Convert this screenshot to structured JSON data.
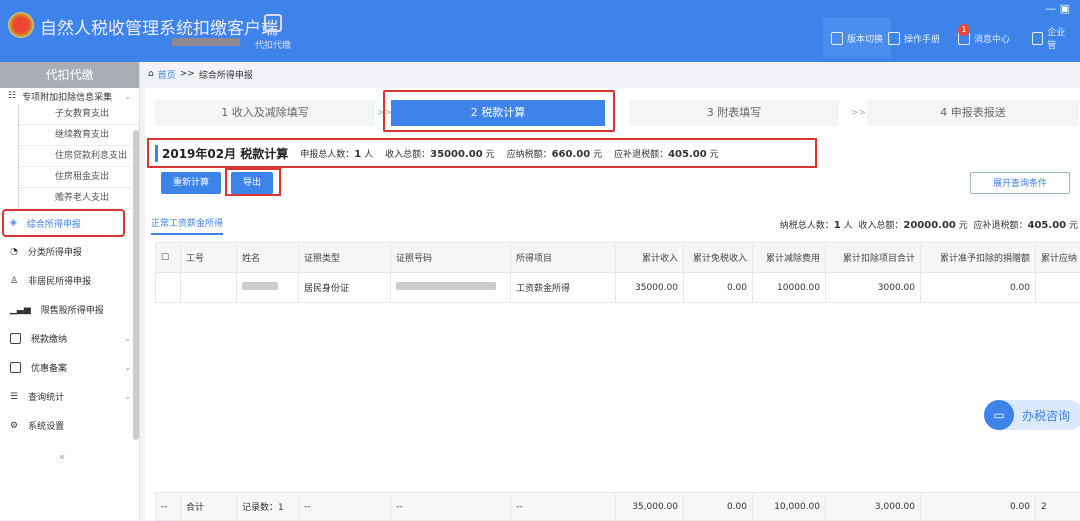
{
  "header": {
    "title": "自然人税收管理系统扣缴客户端",
    "module": "代扣代缴",
    "buttons": [
      "版本切换",
      "操作手册",
      "消息中心",
      "企业管"
    ],
    "message_badge": "1"
  },
  "sidebar": {
    "heading": "代扣代缴",
    "group": "专项附加扣除信息采集",
    "subitems": [
      "子女教育支出",
      "继续教育支出",
      "住房贷款利息支出",
      "住房租金支出",
      "赡养老人支出"
    ],
    "items": [
      "综合所得申报",
      "分类所得申报",
      "非居民所得申报",
      "限售股所得申报",
      "税款缴纳",
      "优惠备案",
      "查询统计",
      "系统设置"
    ],
    "collapse": "«"
  },
  "breadcrumb": {
    "home": "首页",
    "sep": ">>",
    "current": "综合所得申报"
  },
  "steps": [
    "1 收入及减除填写",
    "2 税款计算",
    "3 附表填写",
    "4 申报表报送"
  ],
  "summary": {
    "title": "2019年02月 税款计算",
    "people_label": "申报总人数：",
    "people": "1",
    "people_unit": "人",
    "income_label": "收入总额：",
    "income": "35000.00",
    "tax_label": "应纳税额：",
    "tax": "660.00",
    "refund_label": "应补退税额：",
    "refund": "405.00",
    "unit": "元"
  },
  "buttons": {
    "recalc": "重新计算",
    "export": "导出",
    "expand": "展开查询条件"
  },
  "tab": "正常工资薪金所得",
  "tab_stats": {
    "people_label": "纳税总人数：",
    "people": "1",
    "people_unit": "人",
    "income_label": "收入总额：",
    "income": "20000.00",
    "refund_label": "应补退税额：",
    "refund": "405.00",
    "unit": "元"
  },
  "table": {
    "columns": [
      "工号",
      "姓名",
      "证照类型",
      "证照号码",
      "所得项目",
      "累计收入",
      "累计免税收入",
      "累计减除费用",
      "累计扣除项目合计",
      "累计准予扣除的捐赠额",
      "累计应纳"
    ],
    "rows": [
      [
        "",
        "",
        "居民身份证",
        "",
        "工资薪金所得",
        "35000.00",
        "0.00",
        "10000.00",
        "3000.00",
        "0.00",
        ""
      ]
    ],
    "footer": [
      "--",
      "合计",
      "记录数：1",
      "--",
      "--",
      "--",
      "35,000.00",
      "0.00",
      "10,000.00",
      "3,000.00",
      "0.00",
      "2"
    ]
  },
  "chat": "办税咨询"
}
